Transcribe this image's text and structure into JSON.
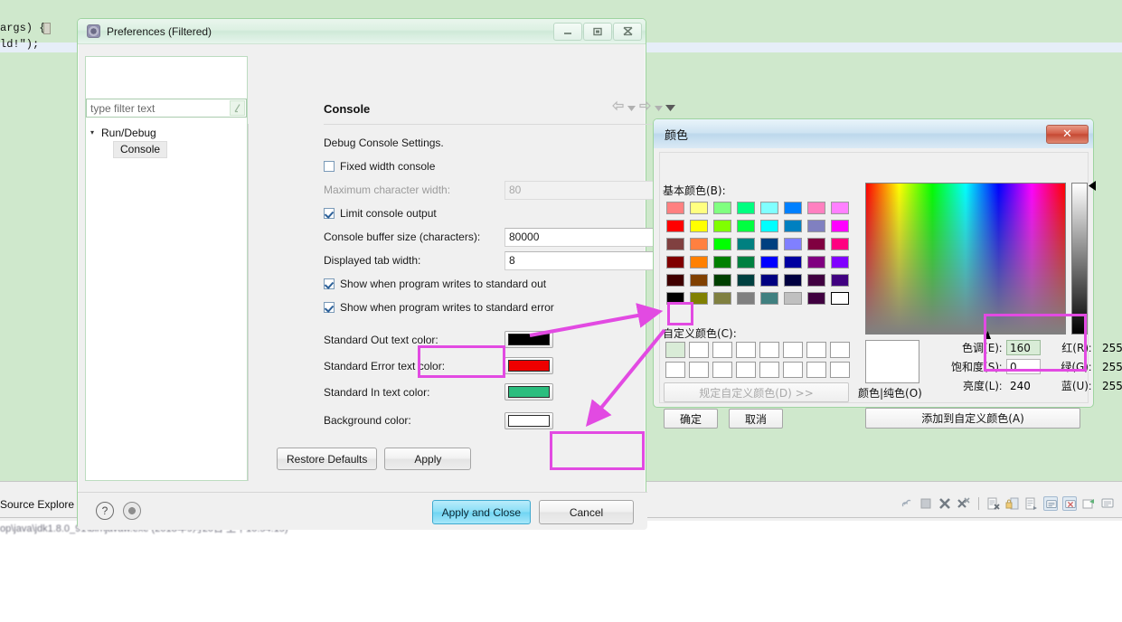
{
  "background": {
    "code_lines": "args) {\nld!\");",
    "tab_label": "Source Explore",
    "console_path": "op\\java\\jdk1.8.0_91\\bin\\javaw.exe (2018年9月20日 上午10:54:15)",
    "editor_bg": "#cfe8cc"
  },
  "console_toolbar": {
    "icons": [
      "link-icon",
      "terminate-icon",
      "remove-launch-icon",
      "remove-all-launches-icon",
      "separator",
      "clear-console-icon",
      "scroll-lock-icon",
      "word-wrap-icon",
      "show-console-icon",
      "pin-console-icon",
      "open-console-icon",
      "display-selected-console-icon"
    ]
  },
  "preferences": {
    "title": "Preferences (Filtered)",
    "window_buttons": [
      "minimize",
      "maximize",
      "close"
    ],
    "filter": {
      "placeholder": "type filter text",
      "value": ""
    },
    "tree": [
      {
        "label": "Run/Debug",
        "expanded": true,
        "level": 0
      },
      {
        "label": "Console",
        "selected": true,
        "level": 1
      }
    ],
    "page_title": "Console",
    "nav_icons": [
      "back-arrow-icon",
      "back-dropdown-icon",
      "forward-arrow-icon",
      "forward-dropdown-icon",
      "menu-dropdown-icon"
    ],
    "section_label": "Debug Console Settings.",
    "fields": {
      "fixed_width_console": {
        "label": "Fixed width console",
        "checked": false
      },
      "max_char_width": {
        "label": "Maximum character width:",
        "value": "80",
        "disabled": true
      },
      "limit_console_output": {
        "label": "Limit console output",
        "checked": true
      },
      "console_buffer_size": {
        "label": "Console buffer size (characters):",
        "value": "80000"
      },
      "displayed_tab_width": {
        "label": "Displayed tab width:",
        "value": "8"
      },
      "show_stdout": {
        "label": "Show when program writes to standard out",
        "checked": true
      },
      "show_stderr": {
        "label": "Show when program writes to standard error",
        "checked": true
      }
    },
    "colors": [
      {
        "label": "Standard Out text color:",
        "value": "#000000"
      },
      {
        "label": "Standard Error text color:",
        "value": "#ee0000"
      },
      {
        "label": "Standard In text color:",
        "value": "#2bbd7e"
      },
      {
        "label": "Background color:",
        "value": "#ffffff",
        "highlighted": true
      }
    ],
    "buttons": {
      "restore_defaults": "Restore Defaults",
      "apply": "Apply",
      "apply_and_close": "Apply and Close",
      "cancel": "Cancel"
    },
    "footer_icons": [
      "help-question-icon",
      "resize-grip-icon"
    ]
  },
  "color_dialog": {
    "title": "颜色",
    "close_glyph": "✕",
    "basic_colors_label": "基本颜色(B):",
    "custom_colors_label": "自定义颜色(C):",
    "define_custom_label": "规定自定义颜色(D) >>",
    "ok_label": "确定",
    "cancel_label": "取消",
    "add_to_custom_label": "添加到自定义颜色(A)",
    "preview_label": "颜色|纯色(O)",
    "preview_color": "#ffffff",
    "basic_colors": [
      [
        "#ff8080",
        "#ffff80",
        "#80ff80",
        "#00ff80",
        "#80ffff",
        "#0080ff",
        "#ff80c0",
        "#ff80ff"
      ],
      [
        "#ff0000",
        "#ffff00",
        "#80ff00",
        "#00ff40",
        "#00ffff",
        "#0080c0",
        "#8080c0",
        "#ff00ff"
      ],
      [
        "#804040",
        "#ff8040",
        "#00ff00",
        "#008080",
        "#004080",
        "#8080ff",
        "#800040",
        "#ff0080"
      ],
      [
        "#800000",
        "#ff8000",
        "#008000",
        "#008040",
        "#0000ff",
        "#0000a0",
        "#800080",
        "#8000ff"
      ],
      [
        "#400000",
        "#804000",
        "#004000",
        "#004040",
        "#000080",
        "#000040",
        "#400040",
        "#400080"
      ],
      [
        "#000000",
        "#808000",
        "#808040",
        "#808080",
        "#408080",
        "#c0c0c0",
        "#400040",
        "#ffffff"
      ]
    ],
    "selected_basic_index": 47,
    "custom_rows": 2,
    "custom_cols": 8,
    "custom_active_index": 0,
    "custom_active_color": "#d9ecd7",
    "hsl": [
      {
        "name": "色调(E)",
        "value": "160",
        "selected": true
      },
      {
        "name": "饱和度(S)",
        "value": "0",
        "selected": false
      },
      {
        "name": "亮度(L)",
        "value": "240",
        "selected": false
      }
    ],
    "rgb": [
      {
        "name": "红(R)",
        "value": "255"
      },
      {
        "name": "绿(G)",
        "value": "255"
      },
      {
        "name": "蓝(U)",
        "value": "255"
      }
    ]
  },
  "annotations": {
    "highlight_color": "#e24ae2",
    "boxes": [
      "background-color-swatch",
      "apply-button",
      "custom-color-swatch",
      "hsl-rgb-values"
    ],
    "arrows": [
      "arrow-to-custom-color",
      "arrow-to-apply-button"
    ]
  }
}
